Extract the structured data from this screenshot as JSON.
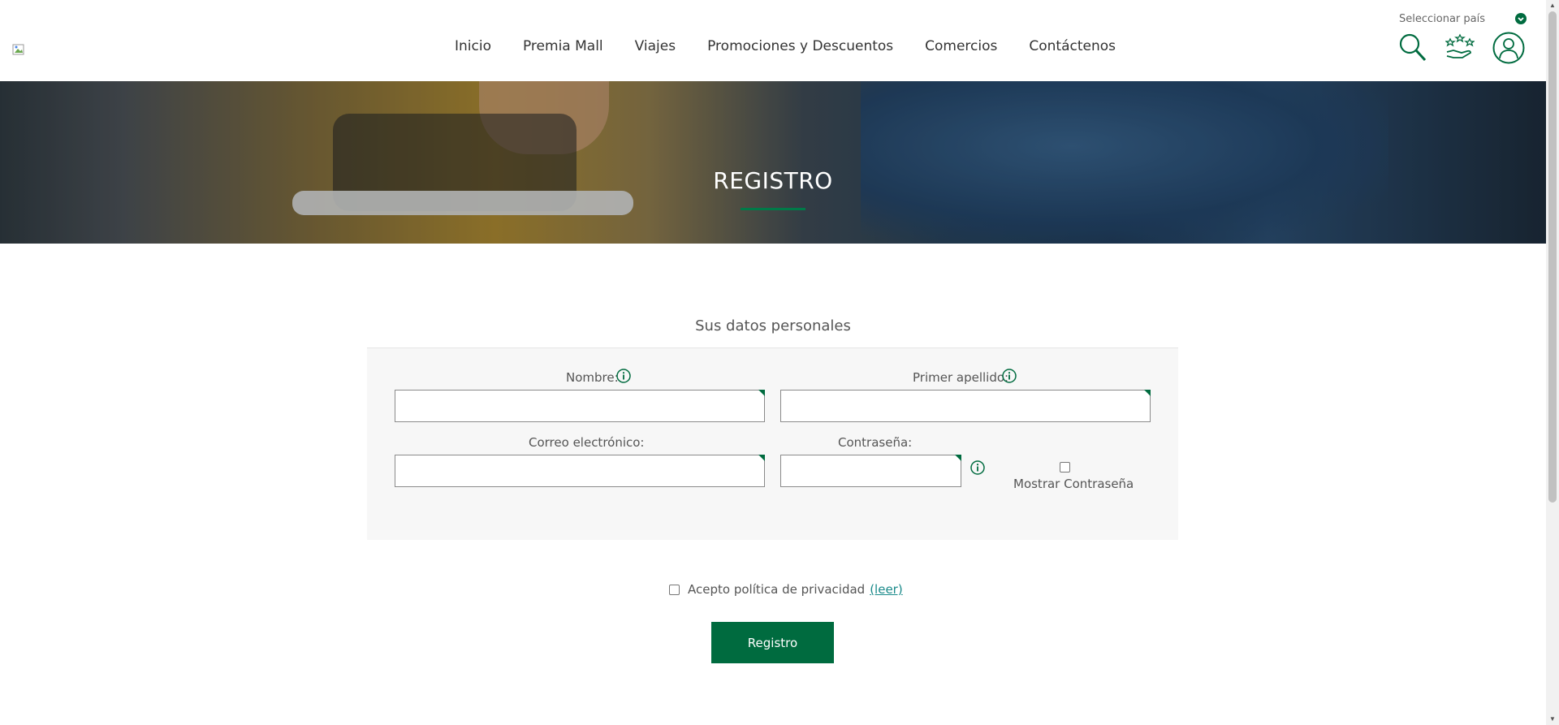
{
  "header": {
    "nav": [
      "Inicio",
      "Premia Mall",
      "Viajes",
      "Promociones y Descuentos",
      "Comercios",
      "Contáctenos"
    ],
    "country_label": "Seleccionar país"
  },
  "hero": {
    "title": "REGISTRO"
  },
  "form": {
    "section_title": "Sus datos personales",
    "nombre_label": "Nombre:",
    "apellido_label": "Primer apellido:",
    "correo_label": "Correo electrónico:",
    "password_label": "Contraseña:",
    "show_password_label": "Mostrar Contraseña",
    "nombre_value": "",
    "apellido_value": "",
    "correo_value": "",
    "password_value": ""
  },
  "privacy": {
    "label": "Acepto política de privacidad",
    "link": "(leer)"
  },
  "submit_label": "Registro",
  "colors": {
    "brand": "#006b3f",
    "link": "#1a8a8a"
  }
}
